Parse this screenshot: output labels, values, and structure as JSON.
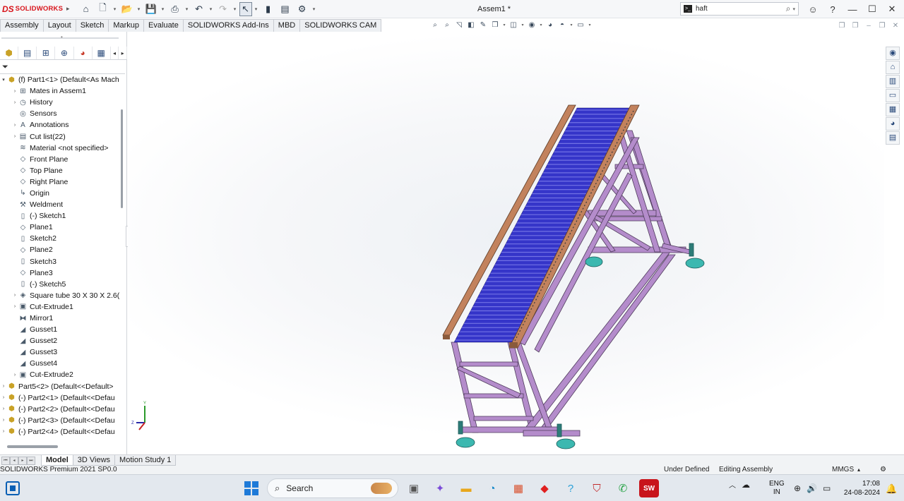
{
  "titlebar": {
    "brand": "SOLIDWORKS",
    "document_title": "Assem1 *",
    "search_value": "haft"
  },
  "command_tabs": [
    "Assembly",
    "Layout",
    "Sketch",
    "Markup",
    "Evaluate",
    "SOLIDWORKS Add-Ins",
    "MBD",
    "SOLIDWORKS CAM"
  ],
  "feature_tree": [
    {
      "label": "(f) Part1<1> (Default<As Mach",
      "icon": "part-icon",
      "exp": "open",
      "indent": 0
    },
    {
      "label": "Mates in Assem1",
      "icon": "mates-icon",
      "exp": "closed",
      "indent": 1
    },
    {
      "label": "History",
      "icon": "history-icon",
      "exp": "closed",
      "indent": 1
    },
    {
      "label": "Sensors",
      "icon": "sensor-icon",
      "exp": "",
      "indent": 1
    },
    {
      "label": "Annotations",
      "icon": "annotation-icon",
      "exp": "closed",
      "indent": 1
    },
    {
      "label": "Cut list(22)",
      "icon": "cut-list-icon",
      "exp": "closed",
      "indent": 1
    },
    {
      "label": "Material <not specified>",
      "icon": "material-icon",
      "exp": "",
      "indent": 1
    },
    {
      "label": "Front Plane",
      "icon": "plane-icon",
      "exp": "",
      "indent": 1
    },
    {
      "label": "Top Plane",
      "icon": "plane-icon",
      "exp": "",
      "indent": 1
    },
    {
      "label": "Right Plane",
      "icon": "plane-icon",
      "exp": "",
      "indent": 1
    },
    {
      "label": "Origin",
      "icon": "origin-icon",
      "exp": "",
      "indent": 1
    },
    {
      "label": "Weldment",
      "icon": "weldment-icon",
      "exp": "",
      "indent": 1
    },
    {
      "label": "(-) Sketch1",
      "icon": "sketch-icon",
      "exp": "",
      "indent": 1
    },
    {
      "label": "Plane1",
      "icon": "plane-icon",
      "exp": "",
      "indent": 1
    },
    {
      "label": "Sketch2",
      "icon": "sketch-icon",
      "exp": "",
      "indent": 1
    },
    {
      "label": "Plane2",
      "icon": "plane-icon",
      "exp": "",
      "indent": 1
    },
    {
      "label": "Sketch3",
      "icon": "sketch-icon",
      "exp": "",
      "indent": 1
    },
    {
      "label": "Plane3",
      "icon": "plane-icon",
      "exp": "",
      "indent": 1
    },
    {
      "label": "(-) Sketch5",
      "icon": "sketch-icon",
      "exp": "",
      "indent": 1
    },
    {
      "label": "Square tube 30 X 30 X 2.6(",
      "icon": "structural-member-icon",
      "exp": "closed",
      "indent": 1
    },
    {
      "label": "Cut-Extrude1",
      "icon": "cut-extrude-icon",
      "exp": "closed",
      "indent": 1
    },
    {
      "label": "Mirror1",
      "icon": "mirror-icon",
      "exp": "",
      "indent": 1
    },
    {
      "label": "Gusset1",
      "icon": "gusset-icon",
      "exp": "",
      "indent": 1
    },
    {
      "label": "Gusset2",
      "icon": "gusset-icon",
      "exp": "",
      "indent": 1
    },
    {
      "label": "Gusset3",
      "icon": "gusset-icon",
      "exp": "",
      "indent": 1
    },
    {
      "label": "Gusset4",
      "icon": "gusset-icon",
      "exp": "",
      "indent": 1
    },
    {
      "label": "Cut-Extrude2",
      "icon": "cut-extrude-icon",
      "exp": "closed",
      "indent": 1
    },
    {
      "label": "Part5<2> (Default<<Default>",
      "icon": "part-icon",
      "exp": "closed",
      "indent": 0
    },
    {
      "label": "(-) Part2<1> (Default<<Defau",
      "icon": "part-icon",
      "exp": "closed",
      "indent": 0
    },
    {
      "label": "(-) Part2<2> (Default<<Defau",
      "icon": "part-icon",
      "exp": "closed",
      "indent": 0
    },
    {
      "label": "(-) Part2<3> (Default<<Defau",
      "icon": "part-icon",
      "exp": "closed",
      "indent": 0
    },
    {
      "label": "(-) Part2<4> (Default<<Defau",
      "icon": "part-icon",
      "exp": "closed",
      "indent": 0
    }
  ],
  "bottom_tabs": [
    {
      "label": "Model",
      "active": true
    },
    {
      "label": "3D Views",
      "active": false
    },
    {
      "label": "Motion Study 1",
      "active": false
    }
  ],
  "statusbar": {
    "product": "SOLIDWORKS Premium 2021 SP0.0",
    "state": "Under Defined",
    "mode": "Editing Assembly",
    "units": "MMGS"
  },
  "taskbar": {
    "search_label": "Search",
    "lang_line1": "ENG",
    "lang_line2": "IN",
    "time": "17:08",
    "date": "24-08-2024"
  },
  "colors": {
    "brand_red": "#d8141b",
    "frame": "#a97ec0",
    "rollers": "#3333c4",
    "side_rail": "#b87955",
    "feet": "#3cb8b0"
  }
}
